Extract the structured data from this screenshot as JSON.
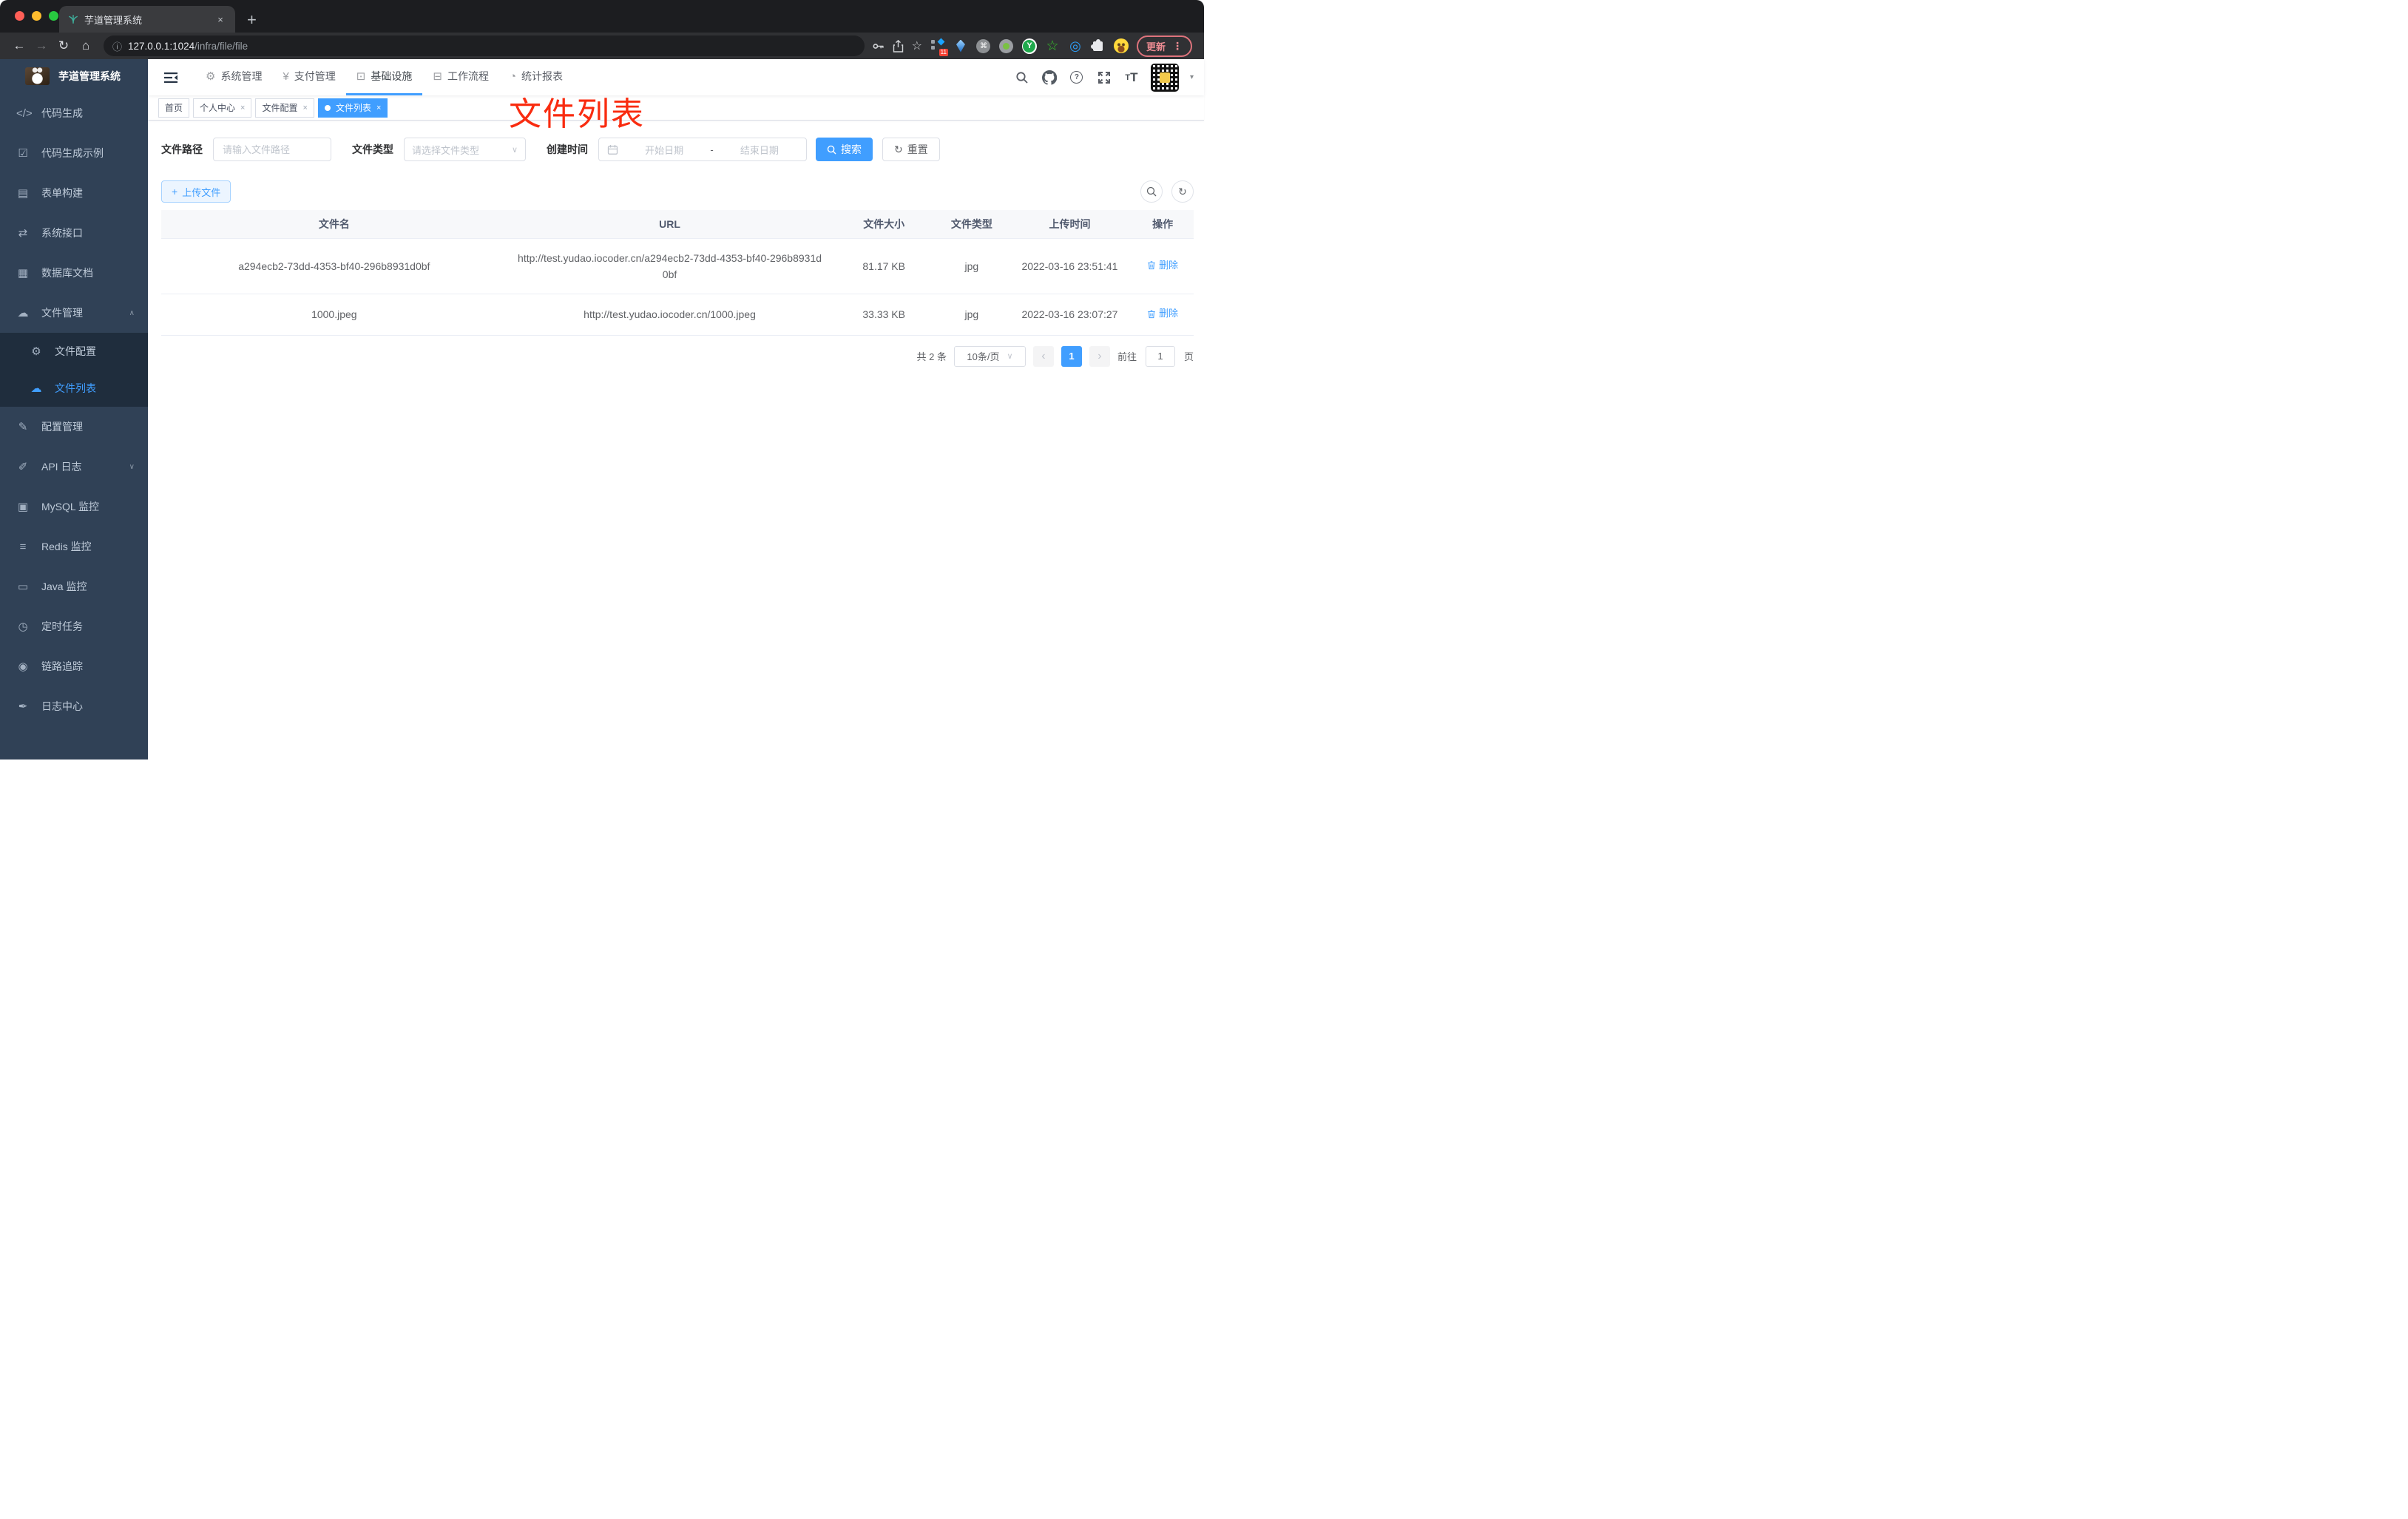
{
  "colors": {
    "accent": "#409eff",
    "annotation_red": "#f92c10",
    "sidebar_bg": "#304156",
    "submenu_bg": "#1f2d3d"
  },
  "browser": {
    "tab_title": "芋道管理系统",
    "tab_close": "×",
    "new_tab": "+",
    "back": "←",
    "forward": "→",
    "reload": "↻",
    "home": "⌂",
    "info": "ⓘ",
    "url_host": "127.0.0.1:1024",
    "url_path": "/infra/file/file",
    "star": "☆",
    "cmd": "⌘",
    "y_letter": "Y",
    "green_star": "☆",
    "blue_rings": "◎",
    "ext_badge": "11",
    "update_label": "更新",
    "menu_dots": "⋮"
  },
  "sidebar": {
    "title": "芋道管理系统",
    "items": [
      {
        "icon": "</>",
        "label": "代码生成"
      },
      {
        "icon": "☑",
        "label": "代码生成示例"
      },
      {
        "icon": "▤",
        "label": "表单构建"
      },
      {
        "icon": "⇄",
        "label": "系统接口"
      },
      {
        "icon": "▦",
        "label": "数据库文档"
      },
      {
        "icon": "☁",
        "label": "文件管理",
        "caret": "∧"
      },
      {
        "icon": "✎",
        "label": "配置管理"
      },
      {
        "icon": "✐",
        "label": "API 日志",
        "caret": "∨"
      },
      {
        "icon": "▣",
        "label": "MySQL 监控"
      },
      {
        "icon": "≡",
        "label": "Redis 监控"
      },
      {
        "icon": "▭",
        "label": "Java 监控"
      },
      {
        "icon": "◷",
        "label": "定时任务"
      },
      {
        "icon": "◉",
        "label": "链路追踪"
      },
      {
        "icon": "✒",
        "label": "日志中心"
      }
    ],
    "submenu_items": [
      {
        "icon": "⚙",
        "label": "文件配置"
      },
      {
        "icon": "☁",
        "label": "文件列表"
      }
    ]
  },
  "app_header": {
    "menus": [
      {
        "icon": "⚙",
        "label": "系统管理"
      },
      {
        "icon": "¥",
        "label": "支付管理"
      },
      {
        "icon": "⊡",
        "label": "基础设施"
      },
      {
        "icon": "⊟",
        "label": "工作流程"
      },
      {
        "icon": "◔",
        "label": "统计报表"
      }
    ],
    "question": "?",
    "font_small": "T",
    "font_large": "T",
    "avatar_caret": "▾"
  },
  "tags": [
    {
      "label": "首页"
    },
    {
      "label": "个人中心",
      "close": "×"
    },
    {
      "label": "文件配置",
      "close": "×"
    },
    {
      "label": "文件列表",
      "close": "×"
    }
  ],
  "annotation": "文件列表",
  "filters": {
    "path_label": "文件路径",
    "path_placeholder": "请输入文件路径",
    "type_label": "文件类型",
    "type_placeholder": "请选择文件类型",
    "select_caret": "∨",
    "date_label": "创建时间",
    "date_start": "开始日期",
    "date_sep": "-",
    "date_end": "结束日期",
    "search_label": "搜索",
    "reset_label": "重置",
    "reset_icon": "↻"
  },
  "toolbar": {
    "plus": "+",
    "upload_label": "上传文件",
    "refresh_icon": "↻"
  },
  "table": {
    "headers": [
      "文件名",
      "URL",
      "文件大小",
      "文件类型",
      "上传时间",
      "操作"
    ],
    "rows": [
      {
        "name": "a294ecb2-73dd-4353-bf40-296b8931d0bf",
        "url": "http://test.yudao.iocoder.cn/a294ecb2-73dd-4353-bf40-296b8931d0bf",
        "size": "81.17 KB",
        "type": "jpg",
        "time": "2022-03-16 23:51:41",
        "action": "删除"
      },
      {
        "name": "1000.jpeg",
        "url": "http://test.yudao.iocoder.cn/1000.jpeg",
        "size": "33.33 KB",
        "type": "jpg",
        "time": "2022-03-16 23:07:27",
        "action": "删除"
      }
    ]
  },
  "pagination": {
    "total": "共 2 条",
    "page_size": "10条/页",
    "caret": "∨",
    "prev": "‹",
    "page": "1",
    "next": "›",
    "goto_label": "前往",
    "goto_value": "1",
    "unit": "页"
  }
}
